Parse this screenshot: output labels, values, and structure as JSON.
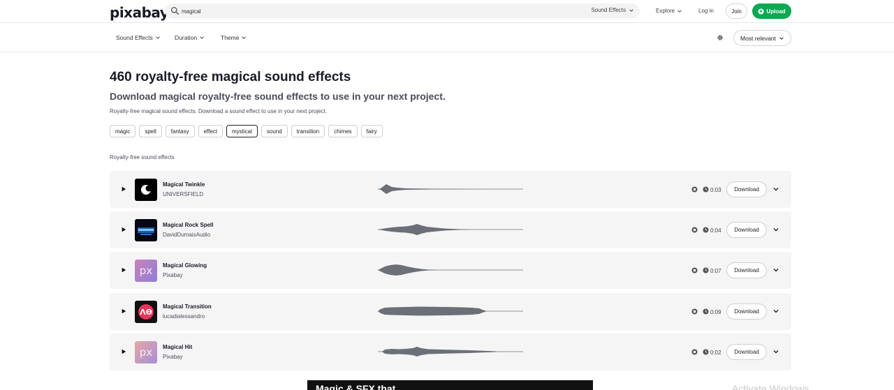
{
  "header": {
    "logo": "pixabay",
    "search_value": "magical",
    "search_type": "Sound Effects",
    "explore": "Explore",
    "login": "Log in",
    "join": "Join",
    "upload": "Upload"
  },
  "filters": {
    "items": [
      {
        "label": "Sound Effects"
      },
      {
        "label": "Duration"
      },
      {
        "label": "Theme"
      }
    ],
    "sort": "Most relevant"
  },
  "main": {
    "title": "460 royalty-free magical sound effects",
    "subtitle": "Download magical royalty-free sound effects to use in your next project.",
    "description": "Royalty-free magical sound effects. Download a sound effect to use in your next project.",
    "tags": [
      "magic",
      "spell",
      "fantasy",
      "effect",
      "mystical",
      "sound",
      "transition",
      "chimes",
      "fairy"
    ],
    "active_tag": "mystical",
    "section_label": "Royalty-free sound effects"
  },
  "tracks": [
    {
      "title": "Magical Twinkle",
      "author": "UNIVERSFIELD",
      "duration": "0:03",
      "download": "Download"
    },
    {
      "title": "Magical Rock Spell",
      "author": "DavidDumaisAudio",
      "duration": "0:04",
      "download": "Download"
    },
    {
      "title": "Magical Glowing",
      "author": "Pixabay",
      "duration": "0:07",
      "download": "Download"
    },
    {
      "title": "Magical Transition",
      "author": "lucadialessandro",
      "duration": "0:09",
      "download": "Download"
    },
    {
      "title": "Magical Hit",
      "author": "Pixabay",
      "duration": "0:02",
      "download": "Download"
    }
  ],
  "bottom": {
    "banner_text": "Magic & SFX that",
    "watermark": "Activate Windows"
  },
  "colors": {
    "accent": "#0ca852",
    "wave": "#6b6f78",
    "row_bg": "#f5f5f5"
  }
}
